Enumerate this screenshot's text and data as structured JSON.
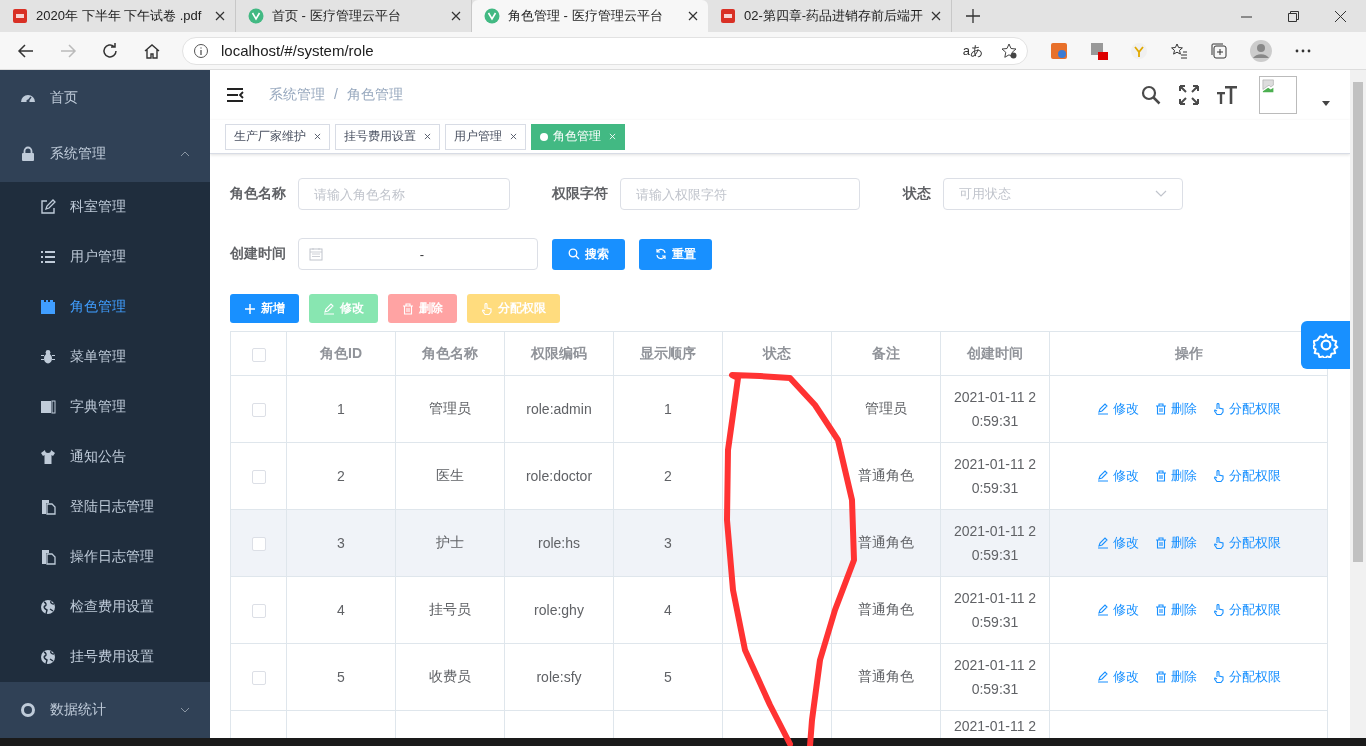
{
  "browser": {
    "tabs": [
      {
        "title": "2020年 下半年 下午试卷 .pdf",
        "kind": "pdf",
        "selected": false
      },
      {
        "title": "首页 - 医疗管理云平台",
        "kind": "site",
        "selected": false
      },
      {
        "title": "角色管理 - 医疗管理云平台",
        "kind": "site",
        "selected": true
      },
      {
        "title": "02-第四章-药品进销存前后端开",
        "kind": "pdf",
        "selected": false
      }
    ],
    "address": "localhost/#/system/role",
    "read_aloud": "aあ"
  },
  "sidebar": {
    "items": [
      {
        "label": "首页",
        "kind": "link"
      },
      {
        "label": "系统管理",
        "kind": "submenu",
        "expanded": true,
        "children": [
          {
            "label": "科室管理",
            "selected": false
          },
          {
            "label": "用户管理",
            "selected": false
          },
          {
            "label": "角色管理",
            "selected": true
          },
          {
            "label": "菜单管理",
            "selected": false
          },
          {
            "label": "字典管理",
            "selected": false
          },
          {
            "label": "通知公告",
            "selected": false
          },
          {
            "label": "登陆日志管理",
            "selected": false
          },
          {
            "label": "操作日志管理",
            "selected": false
          },
          {
            "label": "检查费用设置",
            "selected": false
          },
          {
            "label": "挂号费用设置",
            "selected": false
          }
        ]
      },
      {
        "label": "数据统计",
        "kind": "submenu",
        "expanded": false
      }
    ]
  },
  "header": {
    "breadcrumb": {
      "items": [
        "系统管理",
        "角色管理"
      ],
      "separator": "/"
    }
  },
  "tags": [
    {
      "label": "生产厂家维护",
      "selected": false
    },
    {
      "label": "挂号费用设置",
      "selected": false
    },
    {
      "label": "用户管理",
      "selected": false
    },
    {
      "label": "角色管理",
      "selected": true
    }
  ],
  "filters": [
    {
      "label": "角色名称",
      "kind": "input",
      "placeholder": "请输入角色名称"
    },
    {
      "label": "权限字符",
      "kind": "input",
      "placeholder": "请输入权限字符"
    },
    {
      "label": "状态",
      "kind": "select",
      "placeholder": "可用状态"
    }
  ],
  "date_filter": {
    "label": "创建时间",
    "separator": "-"
  },
  "search_buttons": [
    {
      "label": "搜索",
      "kind": "search"
    },
    {
      "label": "重置",
      "kind": "reset"
    }
  ],
  "toolbar": [
    {
      "label": "新增",
      "kind": "add",
      "disabled": false
    },
    {
      "label": "修改",
      "kind": "edit",
      "disabled": true
    },
    {
      "label": "删除",
      "kind": "delete",
      "disabled": true
    },
    {
      "label": "分配权限",
      "kind": "assign",
      "disabled": true
    }
  ],
  "table": {
    "select_all": {
      "checked": false
    },
    "columns": [
      "角色ID",
      "角色名称",
      "权限编码",
      "显示顺序",
      "状态",
      "备注",
      "创建时间",
      "操作"
    ],
    "rows": [
      {
        "checked": false,
        "highlighted": false,
        "cells": [
          "1",
          "管理员",
          "role:admin",
          "1",
          "",
          "管理员"
        ],
        "created": [
          "2021-01-11 2",
          "0:59:31"
        ],
        "actions": [
          "修改",
          "删除",
          "分配权限"
        ]
      },
      {
        "checked": false,
        "highlighted": false,
        "cells": [
          "2",
          "医生",
          "role:doctor",
          "2",
          "",
          "普通角色"
        ],
        "created": [
          "2021-01-11 2",
          "0:59:31"
        ],
        "actions": [
          "修改",
          "删除",
          "分配权限"
        ]
      },
      {
        "checked": false,
        "highlighted": true,
        "cells": [
          "3",
          "护士",
          "role:hs",
          "3",
          "",
          "普通角色"
        ],
        "created": [
          "2021-01-11 2",
          "0:59:31"
        ],
        "actions": [
          "修改",
          "删除",
          "分配权限"
        ]
      },
      {
        "checked": false,
        "highlighted": false,
        "cells": [
          "4",
          "挂号员",
          "role:ghy",
          "4",
          "",
          "普通角色"
        ],
        "created": [
          "2021-01-11 2",
          "0:59:31"
        ],
        "actions": [
          "修改",
          "删除",
          "分配权限"
        ]
      },
      {
        "checked": false,
        "highlighted": false,
        "cells": [
          "5",
          "收费员",
          "role:sfy",
          "5",
          "",
          "普通角色"
        ],
        "created": [
          "2021-01-11 2",
          "0:59:31"
        ],
        "actions": [
          "修改",
          "删除",
          "分配权限"
        ]
      },
      {
        "highlighted": false,
        "cells": [
          "",
          "",
          "",
          "",
          "",
          ""
        ],
        "created": [
          "2021-01-11 2"
        ],
        "actions": []
      }
    ]
  }
}
